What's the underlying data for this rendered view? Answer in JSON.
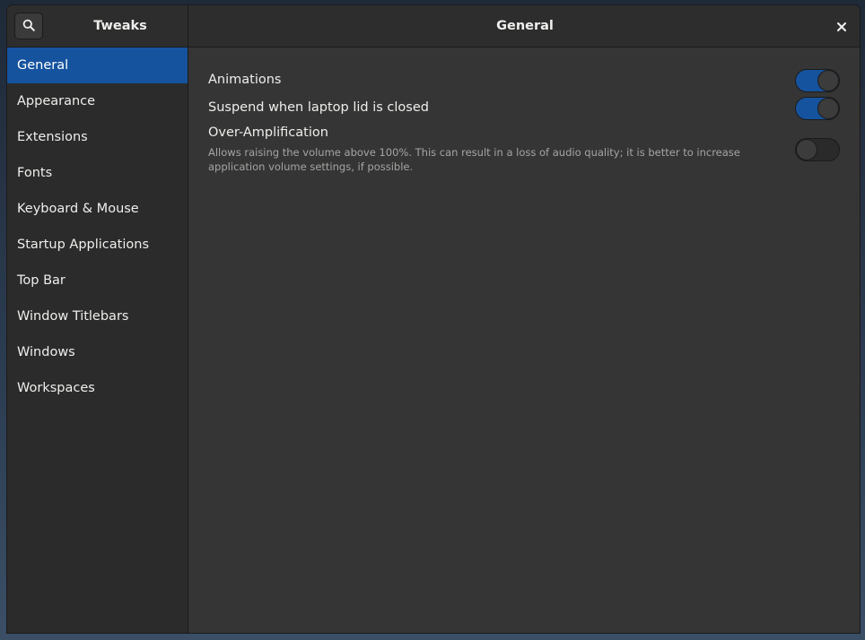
{
  "header": {
    "app_title": "Tweaks",
    "page_title": "General",
    "search_icon": "search-icon",
    "close_icon": "close-icon"
  },
  "sidebar": {
    "items": [
      {
        "label": "General",
        "selected": true
      },
      {
        "label": "Appearance",
        "selected": false
      },
      {
        "label": "Extensions",
        "selected": false
      },
      {
        "label": "Fonts",
        "selected": false
      },
      {
        "label": "Keyboard & Mouse",
        "selected": false
      },
      {
        "label": "Startup Applications",
        "selected": false
      },
      {
        "label": "Top Bar",
        "selected": false
      },
      {
        "label": "Window Titlebars",
        "selected": false
      },
      {
        "label": "Windows",
        "selected": false
      },
      {
        "label": "Workspaces",
        "selected": false
      }
    ]
  },
  "settings": [
    {
      "label": "Animations",
      "enabled": true
    },
    {
      "label": "Suspend when laptop lid is closed",
      "enabled": true
    },
    {
      "label": "Over-Amplification",
      "description": "Allows raising the volume above 100%. This can result in a loss of audio quality; it is better to increase application volume settings, if possible.",
      "enabled": false
    }
  ],
  "colors": {
    "accent": "#15539e",
    "window_bg": "#353535",
    "sidebar_bg": "#2b2b2b"
  }
}
